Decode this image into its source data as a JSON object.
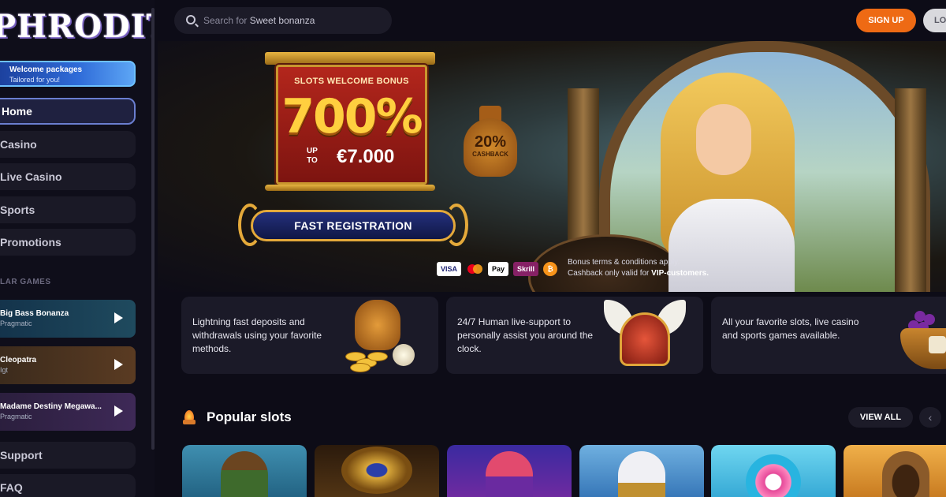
{
  "brand": {
    "logo_text": "PHRODITE"
  },
  "sidebar": {
    "welcome": {
      "line1": "Welcome packages",
      "line2": "Tailored for you!"
    },
    "nav": [
      {
        "label": "Home",
        "active": true
      },
      {
        "label": "Casino"
      },
      {
        "label": "Live Casino"
      },
      {
        "label": "Sports"
      },
      {
        "label": "Promotions"
      }
    ],
    "section_label": "LAR GAMES",
    "games": [
      {
        "name": "Big Bass Bonanza",
        "provider": "Pragmatic"
      },
      {
        "name": "Cleopatra",
        "provider": "Igt"
      },
      {
        "name": "Madame Destiny Megawa...",
        "provider": "Pragmatic"
      }
    ],
    "bottom_nav": [
      {
        "label": "Support"
      },
      {
        "label": "FAQ"
      }
    ]
  },
  "header": {
    "search": {
      "prefix": "Search for",
      "suggestion": "Sweet bonanza"
    },
    "signup_label": "SIGN UP",
    "login_label": "LO"
  },
  "hero": {
    "bonus_label": "SLOTS WELCOME BONUS",
    "bonus_percent": "700%",
    "bonus_up": "UP",
    "bonus_to": "TO",
    "bonus_amount": "€7.000",
    "cashback_pct": "20%",
    "cashback_label": "CASHBACK",
    "cta_label": "FAST REGISTRATION",
    "payments": [
      "VISA",
      "",
      "Pay",
      "Skrill",
      "₿"
    ],
    "terms_line1": "Bonus terms & conditions apply.",
    "terms_line2_prefix": "Cashback only valid for",
    "terms_line2_bold": "VIP-customers."
  },
  "features": [
    {
      "text": "Lightning fast deposits and withdrawals using your favorite methods.",
      "icon": "coin-pot-icon"
    },
    {
      "text": "24/7 Human live-support to personally assist you around the clock.",
      "icon": "winged-helmet-icon"
    },
    {
      "text": "All your favorite slots, live casino and sports games available.",
      "icon": "fruit-bowl-icon"
    }
  ],
  "popular": {
    "title": "Popular slots",
    "view_all": "VIEW ALL",
    "prev_arrow": "‹"
  },
  "colors": {
    "accent_orange": "#ee6a14",
    "bonus_gold": "#ffcf3f",
    "nav_active_border": "#6a7ed0"
  }
}
